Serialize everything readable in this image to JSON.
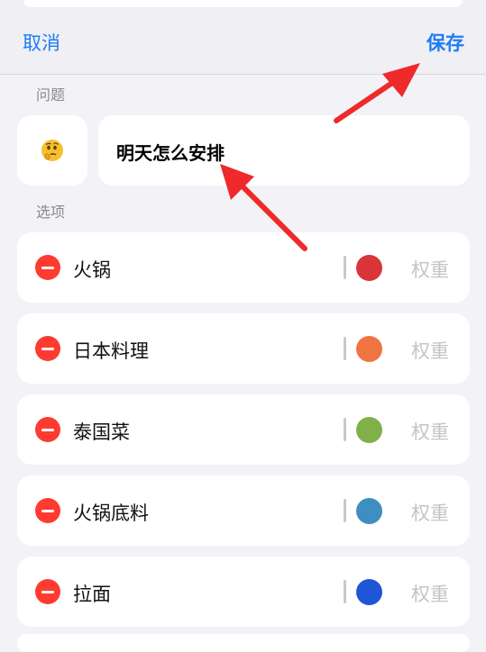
{
  "nav": {
    "cancel_label": "取消",
    "save_label": "保存"
  },
  "question": {
    "section_label": "问题",
    "emoji": "🤔",
    "value": "明天怎么安排"
  },
  "options": {
    "section_label": "选项",
    "weight_placeholder": "权重",
    "items": [
      {
        "label": "火锅",
        "color": "#d93438"
      },
      {
        "label": "日本料理",
        "color": "#ef7441"
      },
      {
        "label": "泰国菜",
        "color": "#80b04a"
      },
      {
        "label": "火锅底料",
        "color": "#3e8fbf"
      },
      {
        "label": "拉面",
        "color": "#1f55d6"
      }
    ]
  },
  "colors": {
    "accent": "#1e7cf2",
    "delete": "#ff3b30",
    "annotation_arrow": "#ee2a2a"
  }
}
